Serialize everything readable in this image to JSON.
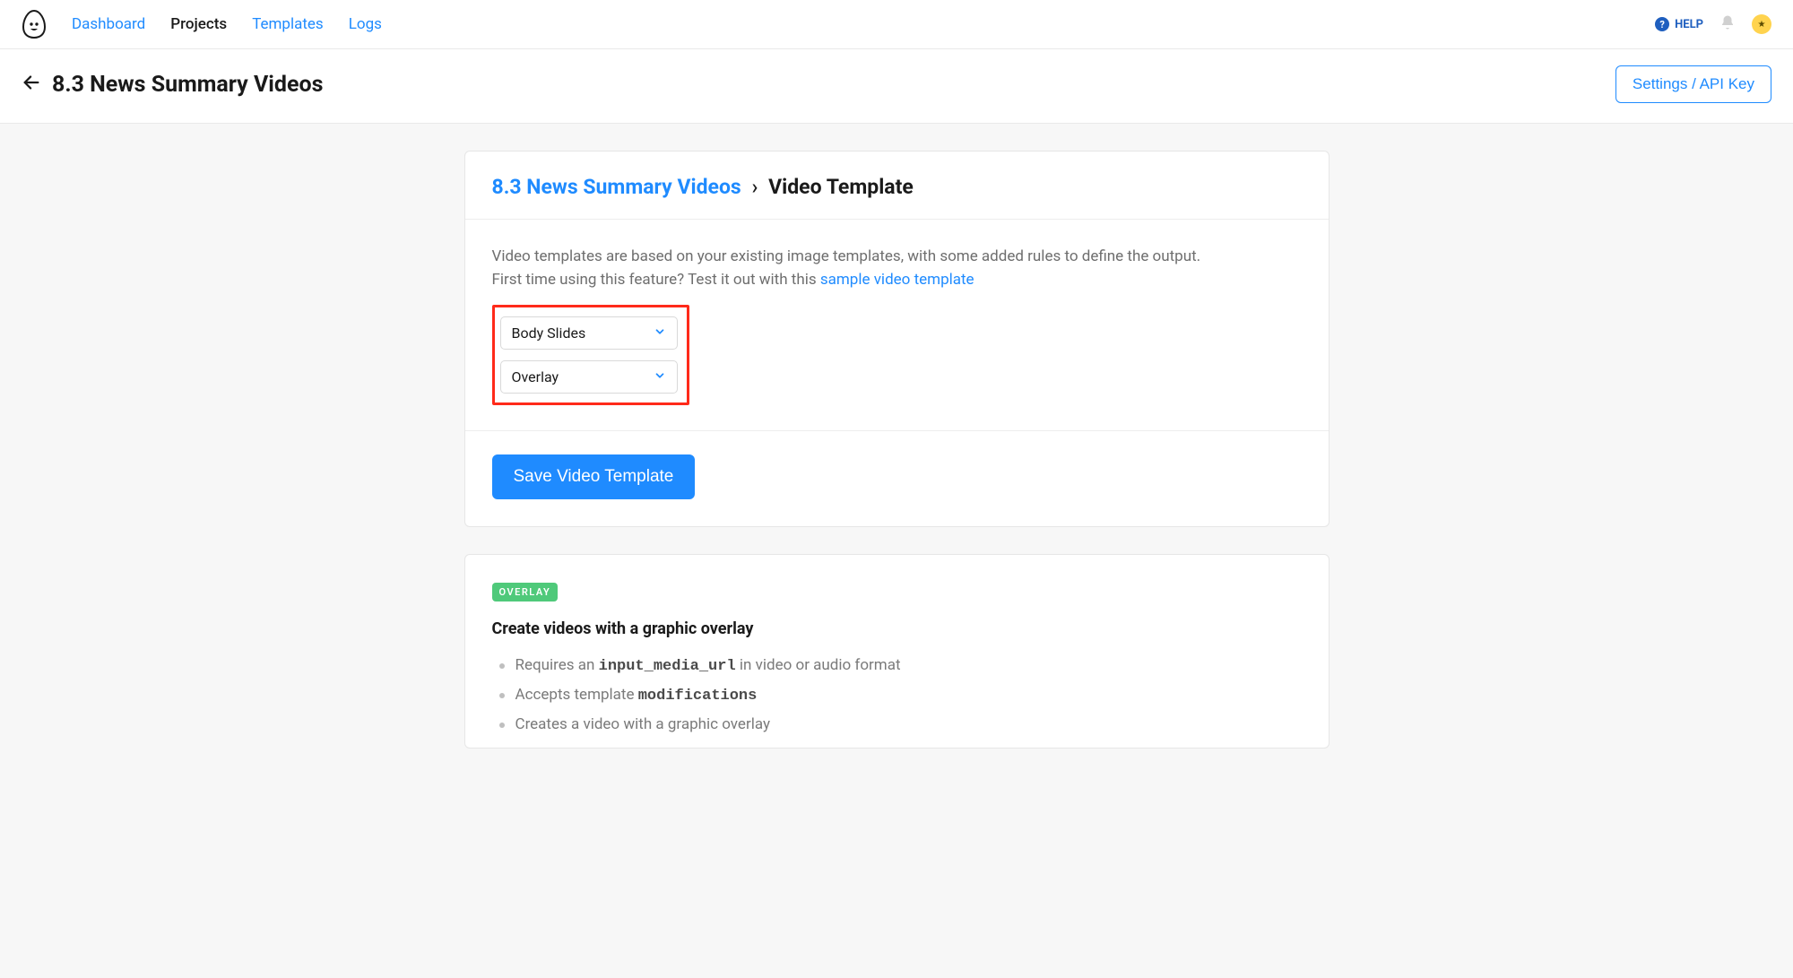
{
  "nav": {
    "dashboard": "Dashboard",
    "projects": "Projects",
    "templates": "Templates",
    "logs": "Logs"
  },
  "topbar": {
    "help_label": "HELP"
  },
  "subheader": {
    "page_title": "8.3 News Summary Videos",
    "settings_label": "Settings / API Key"
  },
  "breadcrumb": {
    "project_link": "8.3 News Summary Videos",
    "separator": "›",
    "current": "Video Template"
  },
  "intro": {
    "line1": "Video templates are based on your existing image templates, with some added rules to define the output.",
    "line2_prefix": "First time using this feature? Test it out with this ",
    "sample_link": "sample video template"
  },
  "selects": {
    "body_slides": "Body Slides",
    "overlay": "Overlay"
  },
  "buttons": {
    "save": "Save Video Template"
  },
  "overlay_section": {
    "badge": "OVERLAY",
    "title": "Create videos with a graphic overlay",
    "bullet1_prefix": "Requires an ",
    "bullet1_code": "input_media_url",
    "bullet1_suffix": " in video or audio format",
    "bullet2_prefix": "Accepts template ",
    "bullet2_code": "modifications",
    "bullet3": "Creates a video with a graphic overlay"
  }
}
